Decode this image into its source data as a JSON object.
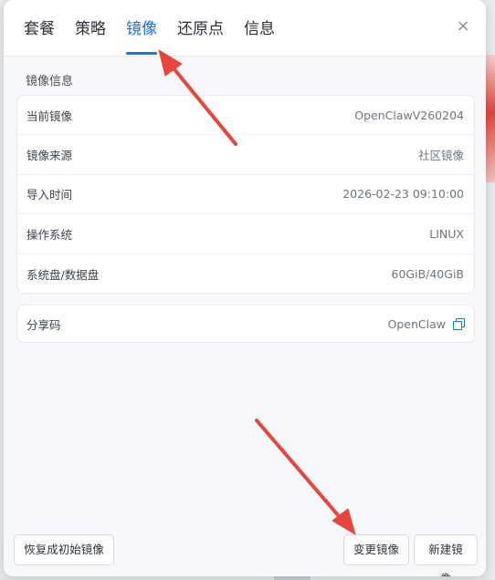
{
  "tabs": [
    {
      "label": "套餐"
    },
    {
      "label": "策略"
    },
    {
      "label": "镜像"
    },
    {
      "label": "还原点"
    },
    {
      "label": "信息"
    }
  ],
  "active_tab": "镜像",
  "close_label": "×",
  "section_title": "镜像信息",
  "info_rows": [
    {
      "label": "当前镜像",
      "value": "OpenClawV260204"
    },
    {
      "label": "镜像来源",
      "value": "社区镜像"
    },
    {
      "label": "导入时间",
      "value": "2026-02-23 09:10:00"
    },
    {
      "label": "操作系统",
      "value": "LINUX"
    },
    {
      "label": "系统盘/数据盘",
      "value": "60GiB/40GiB"
    }
  ],
  "share": {
    "label": "分享码",
    "value": "OpenClaw"
  },
  "buttons": {
    "reset": "恢复成初始镜像",
    "change": "变更镜像",
    "new": "新建镜像"
  },
  "colors": {
    "accent": "#1a73e8",
    "annotation_arrow": "#e8453c"
  }
}
